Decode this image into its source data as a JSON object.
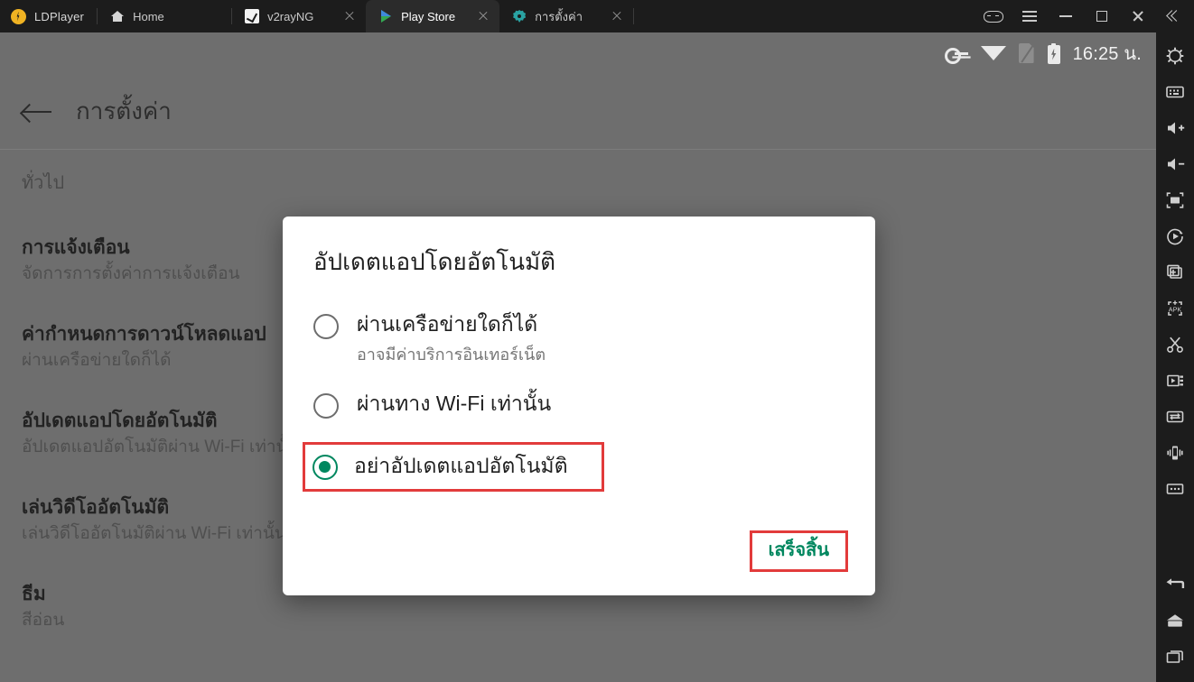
{
  "window": {
    "brand": "LDPlayer",
    "tabs": [
      {
        "label": "Home",
        "icon": "home-icon",
        "closable": false,
        "active": false
      },
      {
        "label": "v2rayNG",
        "icon": "v2rayng-icon",
        "closable": true,
        "active": false
      },
      {
        "label": "Play Store",
        "icon": "play-store-icon",
        "closable": true,
        "active": true
      },
      {
        "label": "การตั้งค่า",
        "icon": "settings-gear-icon",
        "closable": true,
        "active": false
      }
    ],
    "controls": [
      {
        "name": "gamepad-icon"
      },
      {
        "name": "menu-icon"
      },
      {
        "name": "minimize-button"
      },
      {
        "name": "maximize-button"
      },
      {
        "name": "close-button"
      },
      {
        "name": "collapse-button"
      }
    ]
  },
  "statusbar": {
    "time": "16:25 น.",
    "icons": [
      "vpn-key-icon",
      "wifi-icon",
      "no-sim-icon",
      "battery-charging-icon"
    ]
  },
  "appbar": {
    "back_label": "back-arrow-icon",
    "title": "การตั้งค่า"
  },
  "settings": {
    "section_header": "ทั่วไป",
    "rows": [
      {
        "title": "การแจ้งเตือน",
        "sub": "จัดการการตั้งค่าการแจ้งเตือน"
      },
      {
        "title": "ค่ากำหนดการดาวน์โหลดแอป",
        "sub": "ผ่านเครือข่ายใดก็ได้"
      },
      {
        "title": "อัปเดตแอปโดยอัตโนมัติ",
        "sub": "อัปเดตแอปอัตโนมัติผ่าน Wi-Fi เท่านั้น"
      },
      {
        "title": "เล่นวิดีโออัตโนมัติ",
        "sub": "เล่นวิดีโออัตโนมัติผ่าน Wi-Fi เท่านั้น"
      },
      {
        "title": "ธีม",
        "sub": "สีอ่อน"
      }
    ]
  },
  "dialog": {
    "title": "อัปเดตแอปโดยอัตโนมัติ",
    "options": [
      {
        "label": "ผ่านเครือข่ายใดก็ได้",
        "sub": "อาจมีค่าบริการอินเทอร์เน็ต",
        "selected": false,
        "highlighted": false
      },
      {
        "label": "ผ่านทาง Wi-Fi เท่านั้น",
        "sub": "",
        "selected": false,
        "highlighted": false
      },
      {
        "label": "อย่าอัปเดตแอปอัตโนมัติ",
        "sub": "",
        "selected": true,
        "highlighted": true
      }
    ],
    "done_label": "เสร็จสิ้น",
    "accent_color": "#00875f",
    "highlight_color": "#e23b3b"
  },
  "sidebar": {
    "items": [
      "settings-gear-icon",
      "keyboard-icon",
      "volume-up-icon",
      "volume-down-icon",
      "fullscreen-icon",
      "rotate-play-icon",
      "new-window-icon",
      "install-apk-icon",
      "screenshot-scissors-icon",
      "screen-record-icon",
      "sync-transfer-icon",
      "shake-device-icon",
      "more-options-icon"
    ],
    "nav_items": [
      "back-nav-icon",
      "home-nav-icon",
      "recents-nav-icon"
    ]
  }
}
